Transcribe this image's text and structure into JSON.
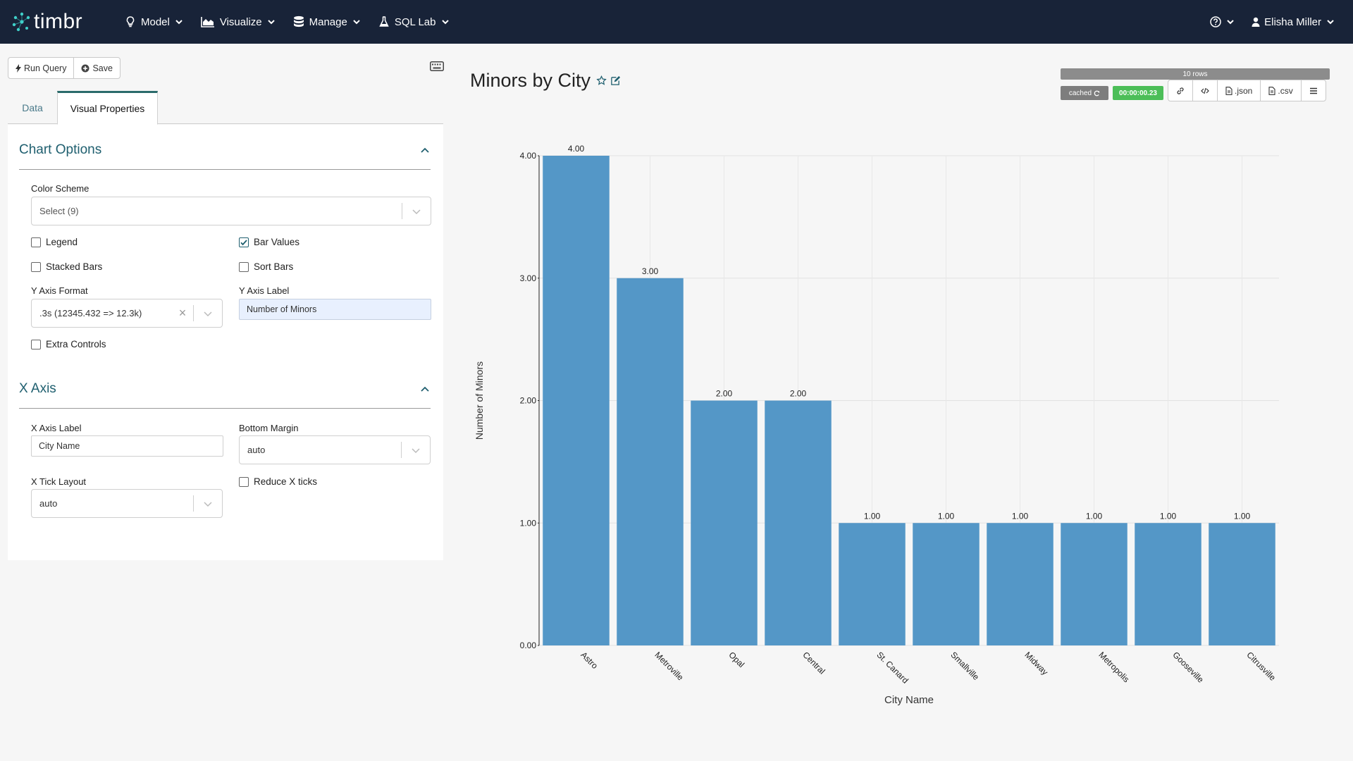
{
  "navbar": {
    "brand": "timbr",
    "menu": [
      {
        "label": "Model",
        "icon": "lightbulb-icon"
      },
      {
        "label": "Visualize",
        "icon": "area-chart-icon"
      },
      {
        "label": "Manage",
        "icon": "database-icon"
      },
      {
        "label": "SQL Lab",
        "icon": "flask-icon"
      }
    ],
    "help_icon": "question-circle-icon",
    "user": {
      "name": "Elisha Miller",
      "icon": "user-icon"
    }
  },
  "toolbar": {
    "run_label": "Run Query",
    "save_label": "Save",
    "run_icon": "bolt-icon",
    "save_icon": "plus-circle-icon"
  },
  "tabs": [
    {
      "label": "Data",
      "active": false
    },
    {
      "label": "Visual Properties",
      "active": true
    }
  ],
  "chart_options": {
    "title": "Chart Options",
    "color_scheme": {
      "label": "Color Scheme",
      "placeholder": "Select (9)"
    },
    "legend": {
      "label": "Legend",
      "checked": false
    },
    "bar_values": {
      "label": "Bar Values",
      "checked": true
    },
    "stacked_bars": {
      "label": "Stacked Bars",
      "checked": false
    },
    "sort_bars": {
      "label": "Sort Bars",
      "checked": false
    },
    "y_axis_format": {
      "label": "Y Axis Format",
      "value": ".3s (12345.432 => 12.3k)"
    },
    "y_axis_label": {
      "label": "Y Axis Label",
      "value": "Number of Minors"
    },
    "extra_controls": {
      "label": "Extra Controls",
      "checked": false
    }
  },
  "x_axis": {
    "title": "X Axis",
    "x_axis_label": {
      "label": "X Axis Label",
      "value": "City Name"
    },
    "bottom_margin": {
      "label": "Bottom Margin",
      "value": "auto"
    },
    "x_tick_layout": {
      "label": "X Tick Layout",
      "value": "auto"
    },
    "reduce_x_ticks": {
      "label": "Reduce X ticks",
      "checked": false
    }
  },
  "main": {
    "chart_title": "Minors by City",
    "rows": "10 rows",
    "cached": "cached",
    "elapsed": "00:00:00.23",
    "exports": [
      {
        "label": "",
        "icon": "link-icon"
      },
      {
        "label": "",
        "icon": "code-icon"
      },
      {
        "label": ".json",
        "icon": "file-icon"
      },
      {
        "label": ".csv",
        "icon": "file-icon"
      },
      {
        "label": "",
        "icon": "bars-icon"
      }
    ]
  },
  "colors": {
    "navbar": "#182338",
    "bar": "#5497c7",
    "accent": "#1f5f6f",
    "time_badge": "#4cbe58"
  },
  "chart_data": {
    "type": "bar",
    "categories": [
      "Astro",
      "Metroville",
      "Opal",
      "Central",
      "St. Canard",
      "Smallville",
      "Midway",
      "Metropolis",
      "Gooseville",
      "Citrusville"
    ],
    "values": [
      4,
      3,
      2,
      2,
      1,
      1,
      1,
      1,
      1,
      1
    ],
    "bar_labels": [
      "4.00",
      "3.00",
      "2.00",
      "2.00",
      "1.00",
      "1.00",
      "1.00",
      "1.00",
      "1.00",
      "1.00"
    ],
    "xlabel": "City Name",
    "ylabel": "Number of Minors",
    "ylim": [
      0,
      4
    ],
    "yticks": [
      0,
      1,
      2,
      3,
      4
    ],
    "ytick_labels": [
      "0.00",
      "1.00",
      "2.00",
      "3.00",
      "4.00"
    ],
    "grid": true,
    "legend": false
  }
}
